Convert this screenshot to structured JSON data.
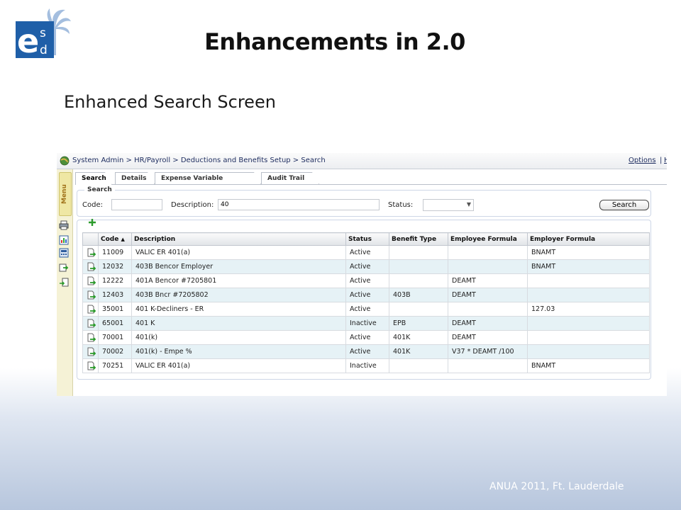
{
  "slide": {
    "title": "Enhancements in 2.0",
    "subtitle": "Enhanced Search Screen",
    "footer": "ANUA 2011, Ft. Lauderdale",
    "logo_letters": [
      "e",
      "s",
      "d"
    ]
  },
  "app": {
    "breadcrumb": "System Admin > HR/Payroll > Deductions and Benefits Setup > Search",
    "options_label": "Options",
    "options_sep": "|",
    "options_more": "H",
    "menu_label": "Menu",
    "tabs": [
      "Search",
      "Details",
      "Expense Variable Masking",
      "Audit Trail"
    ],
    "search_panel": {
      "legend": "Search",
      "code_label": "Code:",
      "code_value": "",
      "description_label": "Description:",
      "description_value": "40",
      "status_label": "Status:",
      "status_value": "",
      "search_button": "Search"
    },
    "grid": {
      "columns": [
        "Code",
        "Description",
        "Status",
        "Benefit Type",
        "Employee Formula",
        "Employer Formula"
      ],
      "sort_indicator": "▲",
      "rows": [
        [
          "11009",
          "VALIC ER 401(a)",
          "Active",
          "",
          "",
          "BNAMT"
        ],
        [
          "12032",
          "403B Bencor Employer",
          "Active",
          "",
          "",
          "BNAMT"
        ],
        [
          "12222",
          "401A Bencor #7205801",
          "Active",
          "",
          "DEAMT",
          ""
        ],
        [
          "12403",
          "403B Bncr #7205802",
          "Active",
          "403B",
          "DEAMT",
          ""
        ],
        [
          "35001",
          "401 K-Decliners - ER",
          "Active",
          "",
          "",
          "127.03"
        ],
        [
          "65001",
          "401 K",
          "Inactive",
          "EPB",
          "DEAMT",
          ""
        ],
        [
          "70001",
          "401(k)",
          "Active",
          "401K",
          "DEAMT",
          ""
        ],
        [
          "70002",
          "401(k) - Empe %",
          "Active",
          "401K",
          "V37 * DEAMT /100",
          ""
        ],
        [
          "70251",
          "VALIC ER 401(a)",
          "Inactive",
          "",
          "",
          "BNAMT"
        ]
      ]
    }
  },
  "colors": {
    "logo_blue": "#1f5fa8",
    "logo_palm": "#8fb0d6",
    "alt_row": "#e6f2f6",
    "sidebar": "#f5f2d6",
    "menu_text": "#a0721a",
    "footer_bg": "#b7c6dd"
  },
  "icons": [
    "globe-icon",
    "printer-icon",
    "report-icon",
    "calculator-icon",
    "export-icon",
    "doc-icon",
    "add-icon",
    "select-row-icon"
  ]
}
